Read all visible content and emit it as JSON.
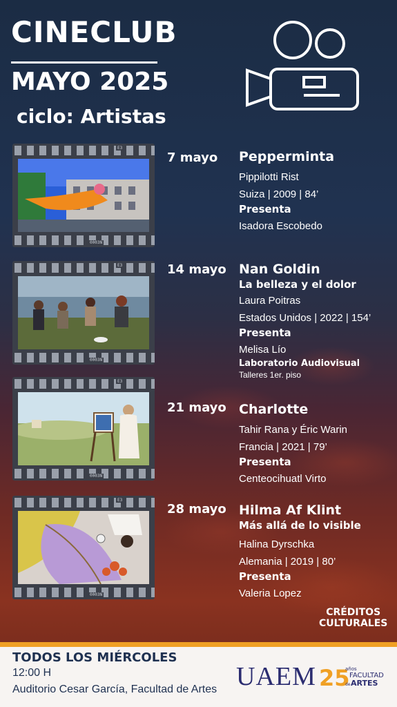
{
  "header": {
    "title": "CINECLUB",
    "month": "MAYO 2025",
    "cycle": "ciclo: Artistas"
  },
  "camera_icon": "movie-camera-icon",
  "films": [
    {
      "date": "7 mayo",
      "title": "Pepperminta",
      "subtitle": "",
      "director": "Pippilotti Rist",
      "details": "Suiza | 2009 | 84’",
      "presenta_label": "Presenta",
      "presenter": "Isadora Escobedo"
    },
    {
      "date": "14 mayo",
      "title": "Nan Goldin",
      "subtitle": "La belleza y el dolor",
      "director": "Laura Poitras",
      "details": "Estados Unidos | 2022 | 154’",
      "presenta_label": "Presenta",
      "presenter": "Melisa Lío",
      "venue_label": "Laboratorio Audiovisual",
      "venue_detail": "Talleres 1er. piso"
    },
    {
      "date": "21 mayo",
      "title": "Charlotte",
      "subtitle": "",
      "director": "Tahir Rana y Éric Warin",
      "details": "Francia | 2021 | 79’",
      "presenta_label": "Presenta",
      "presenter": "Centeocihuatl Virto"
    },
    {
      "date": "28 mayo",
      "title": "Hilma Af Klint",
      "subtitle": "Más allá de lo visible",
      "director": "Halina Dyrschka",
      "details": "Alemania | 2019 | 80’",
      "presenta_label": "Presenta",
      "presenter": "Valeria Lopez"
    }
  ],
  "film_strip_marks": [
    "E3",
    "NE3",
    "8E",
    "0003N",
    "NE300"
  ],
  "credits": {
    "line1": "CRÉDITOS",
    "line2": "CULTURALES"
  },
  "footer": {
    "when": "TODOS LOS MIÉRCOLES",
    "time": "12:00 H",
    "place": "Auditorio Cesar García, Facultad de Artes",
    "uaem_logo": "UAEM",
    "faculty_logo_number": "25",
    "faculty_logo_years": "años",
    "faculty_logo_line1": "FACULTAD",
    "faculty_logo_line2": "ARTES",
    "faculty_logo_de": "de"
  },
  "colors": {
    "navy": "#1f3151",
    "orange": "#f0a024",
    "uaem_blue": "#2b2c70"
  }
}
